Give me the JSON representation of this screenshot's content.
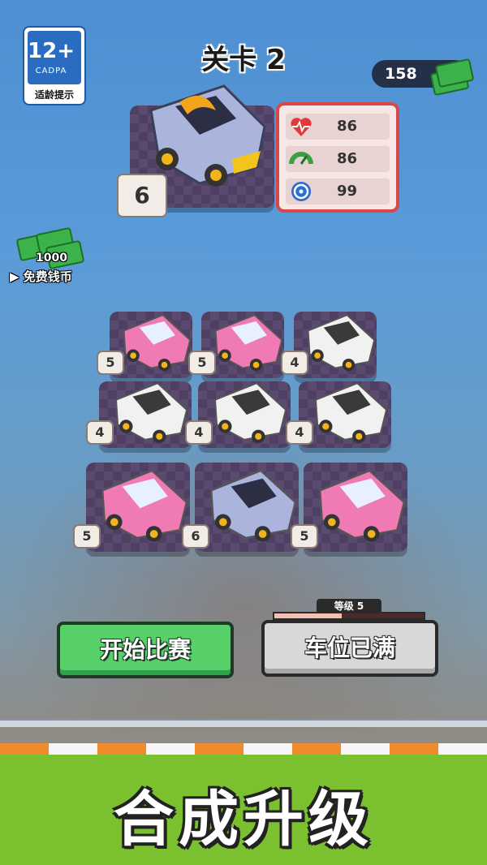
{
  "age_rating": {
    "number": "12+",
    "org": "CADPA",
    "tip": "适龄提示"
  },
  "level": {
    "title": "关卡 2"
  },
  "currency": {
    "amount": "158"
  },
  "featured_car": {
    "level": "6"
  },
  "stats": {
    "health": "86",
    "acceleration": "86",
    "handling": "99"
  },
  "free_coins": {
    "amount": "1000",
    "label": "免费钱币"
  },
  "grid": [
    {
      "level": "5",
      "color": "pink"
    },
    {
      "level": "5",
      "color": "pink"
    },
    {
      "level": "4",
      "color": "white"
    },
    {
      "level": "4",
      "color": "white"
    },
    {
      "level": "4",
      "color": "white"
    },
    {
      "level": "4",
      "color": "white"
    },
    {
      "level": "5",
      "color": "pink"
    },
    {
      "level": "6",
      "color": "silver"
    },
    {
      "level": "5",
      "color": "pink"
    }
  ],
  "garage": {
    "grade_label": "等级 5",
    "progress": 0.45
  },
  "buttons": {
    "start": "开始比赛",
    "full": "车位已满"
  },
  "slogan": "合成升级",
  "colors": {
    "pink_car": "#f07ab4",
    "white_car": "#f1f1f1",
    "silver_car": "#aab4dc",
    "start_green": "#57d06a",
    "accent_red": "#d84848"
  }
}
